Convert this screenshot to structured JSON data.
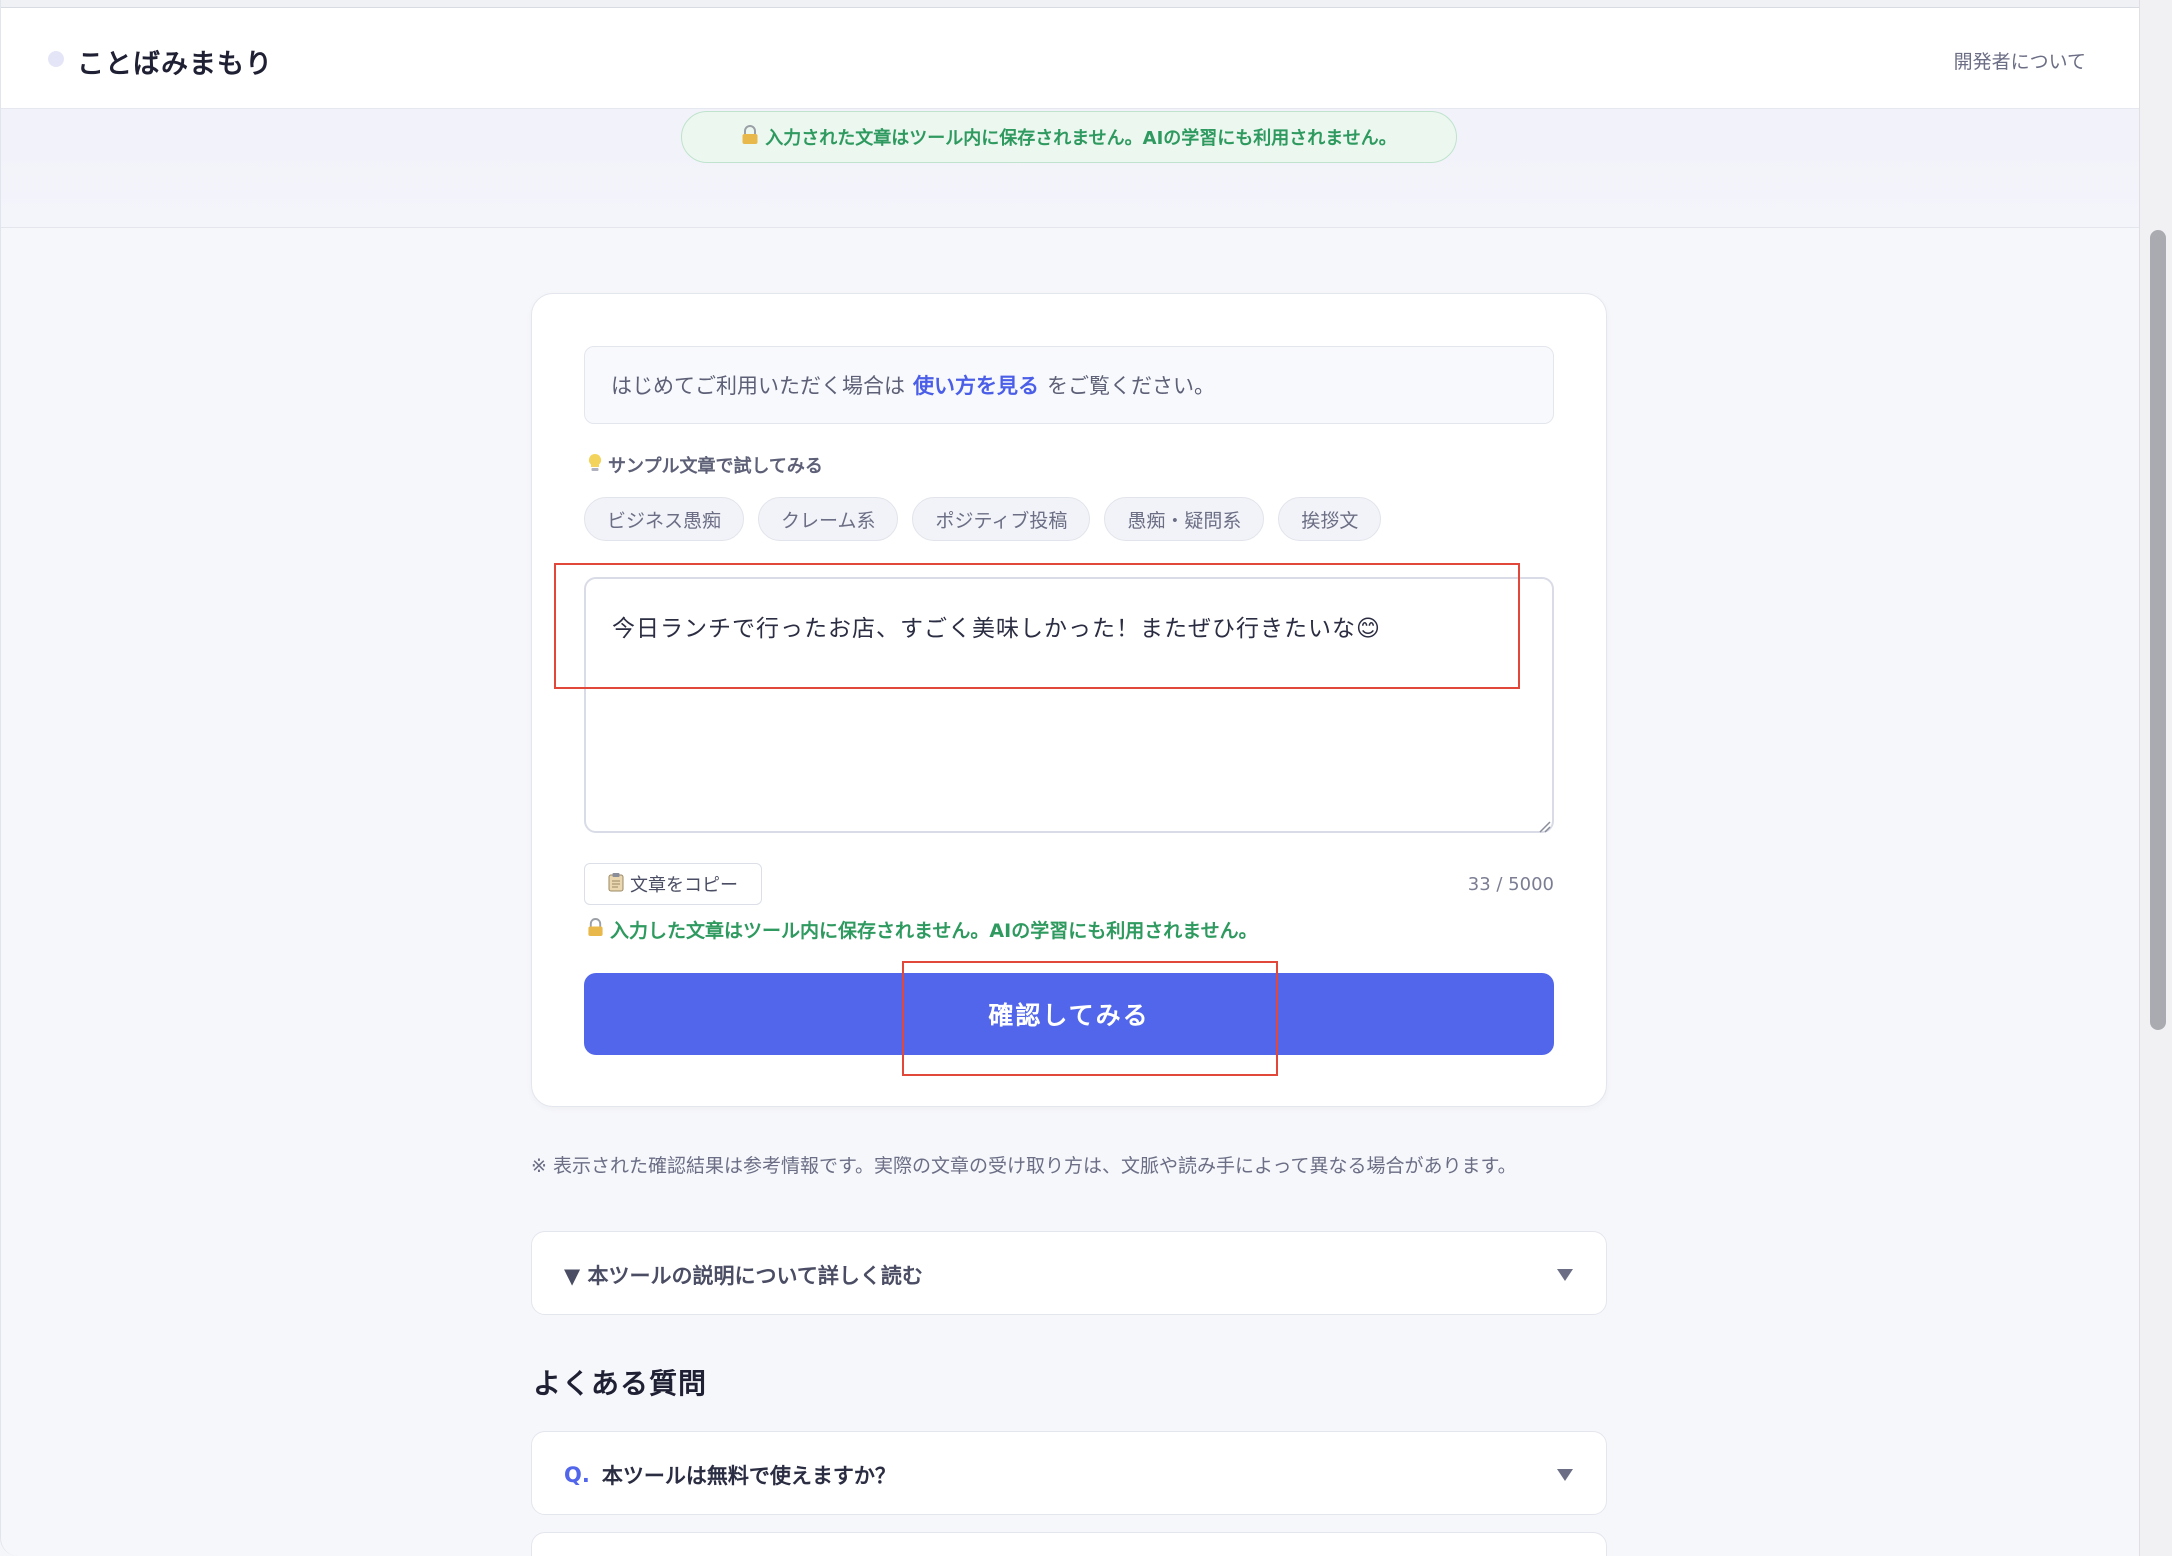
{
  "header": {
    "logo_text": "ことばみまもり",
    "about_link": "開発者について"
  },
  "hero": {
    "privacy_banner": "入力された文章はツール内に保存されません。AIの学習にも利用されません。"
  },
  "guide": {
    "prefix": "はじめてご利用いただく場合は",
    "link": "使い方を見る",
    "suffix": "をご覧ください。"
  },
  "samples": {
    "heading": "サンプル文章で試してみる",
    "chips": [
      "ビジネス愚痴",
      "クレーム系",
      "ポジティブ投稿",
      "愚痴・疑問系",
      "挨拶文"
    ]
  },
  "editor": {
    "value": "今日ランチで行ったお店、すごく美味しかった！またぜひ行きたいな😊",
    "copy_label": "文章をコピー",
    "char_count": "33 / 5000",
    "privacy_note": "入力した文章はツール内に保存されません。AIの学習にも利用されません。",
    "submit_label": "確認してみる"
  },
  "disclaimer": "※ 表示された確認結果は参考情報です。実際の文章の受け取り方は、文脈や読み手によって異なる場合があります。",
  "details": {
    "label": "▼ 本ツールの説明について詳しく読む"
  },
  "faq": {
    "heading": "よくある質問",
    "items": [
      {
        "q": "Q.",
        "text": "本ツールは無料で使えますか？"
      }
    ]
  },
  "colors": {
    "accent": "#5166ea",
    "privacy_green": "#2f9a5f",
    "annotation_red": "#e2483a"
  }
}
